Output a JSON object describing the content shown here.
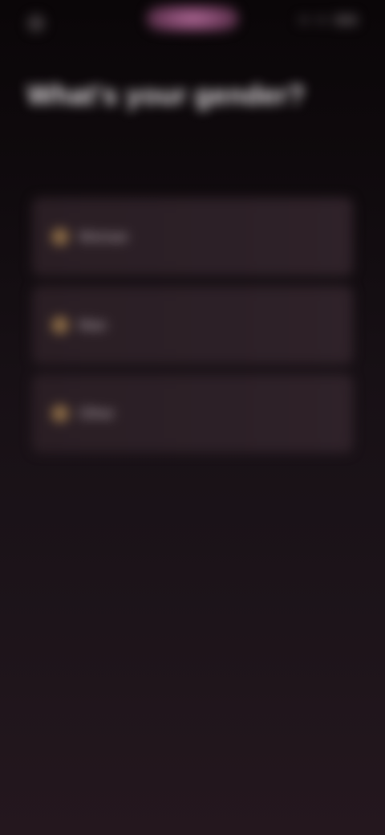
{
  "status_bar": {
    "time": "",
    "pill_label": ""
  },
  "header": {
    "title": "What's your gender?"
  },
  "options": [
    {
      "label": "Woman",
      "icon": "circle-icon"
    },
    {
      "label": "Man",
      "icon": "circle-icon"
    },
    {
      "label": "Other",
      "icon": "circle-icon"
    }
  ],
  "colors": {
    "background_top": "#0a0608",
    "background_bottom": "#24171e",
    "card": "#2c2027",
    "accent": "#b06a97",
    "icon": "#8a6a45"
  }
}
